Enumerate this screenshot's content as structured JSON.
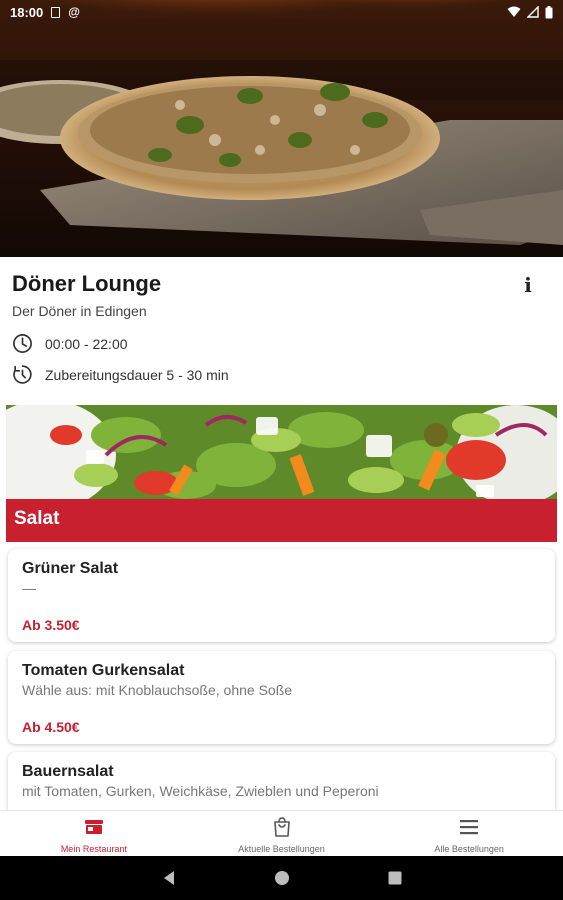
{
  "status_bar": {
    "time": "18:00",
    "at_symbol": "@"
  },
  "restaurant": {
    "name": "Döner Lounge",
    "subtitle": "Der Döner in Edingen",
    "hours": "00:00 - 22:00",
    "prep_time": "Zubereitungsdauer 5 - 30 min",
    "info_icon": "i"
  },
  "category": {
    "title": "Salat"
  },
  "items": [
    {
      "name": "Grüner Salat",
      "description": "—",
      "price": "Ab 3.50€"
    },
    {
      "name": "Tomaten Gurkensalat",
      "description": "Wähle aus: mit Knoblauchsoße, ohne Soße",
      "price": "Ab 4.50€"
    },
    {
      "name": "Bauernsalat",
      "description": "mit Tomaten, Gurken, Weichkäse, Zwieblen und Peperoni",
      "price": ""
    }
  ],
  "bottom_nav": {
    "items": [
      {
        "label": "Mein Restaurant",
        "icon": "store-icon",
        "active": true
      },
      {
        "label": "Aktuelle Bestellungen",
        "icon": "shopping-bag-icon",
        "active": false
      },
      {
        "label": "Alle Bestellungen",
        "icon": "menu-icon",
        "active": false
      }
    ]
  },
  "colors": {
    "accent": "#c8202f",
    "text": "#222222",
    "muted": "#777777"
  }
}
